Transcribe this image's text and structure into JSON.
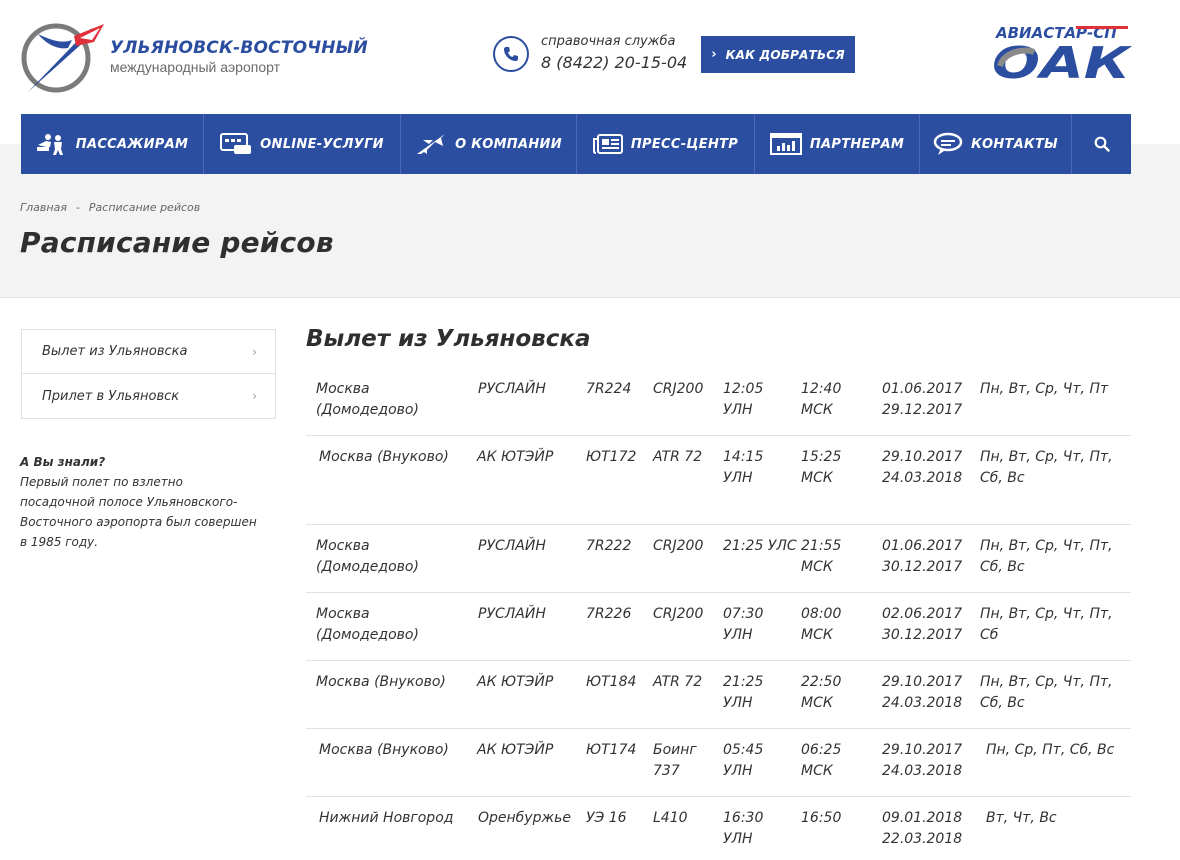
{
  "header": {
    "logo_title": "УЛЬЯНОВСК-ВОСТОЧНЫЙ",
    "logo_subtitle": "международный аэропорт",
    "phone_label": "справочная служба",
    "phone_number": "8 (8422) 20-15-04",
    "route_button": "КАК ДОБРАТЬСЯ",
    "partner_logo_top": "АВИАСТАР-СП",
    "partner_logo_main": "ОАК"
  },
  "nav": {
    "items": [
      {
        "label": "ПАССАЖИРАМ",
        "icon": "passengers-icon"
      },
      {
        "label": "ONLINE-УСЛУГИ",
        "icon": "online-services-icon"
      },
      {
        "label": "О КОМПАНИИ",
        "icon": "airplane-icon"
      },
      {
        "label": "ПРЕСС-ЦЕНТР",
        "icon": "newspaper-icon"
      },
      {
        "label": "ПАРТНЕРАМ",
        "icon": "chart-icon"
      },
      {
        "label": "КОНТАКТЫ",
        "icon": "chat-bubbles-icon"
      }
    ],
    "search_icon": "search-icon"
  },
  "breadcrumb": {
    "home": "Главная",
    "separator": "-",
    "current": "Расписание рейсов"
  },
  "page_title": "Расписание рейсов",
  "sidebar": {
    "items": [
      {
        "label": "Вылет из Ульяновска"
      },
      {
        "label": "Прилет в Ульяновск"
      }
    ],
    "fact_title": "А Вы знали?",
    "fact_text": "Первый полет по взлетно посадочной полосе Ульяновского-Восточного аэропорта был совершен в 1985 году."
  },
  "schedule": {
    "title": "Вылет из Ульяновска",
    "rows": [
      {
        "dest": "Москва (Домодедово)",
        "airline": "РУСЛАЙН",
        "flight": "7R224",
        "aircraft": "CRJ200",
        "dep": "12:05 УЛН",
        "arr": "12:40 МСК",
        "period": "01.06.2017 29.12.2017",
        "days": "Пн, Вт, Ср, Чт, Пт"
      },
      {
        "dest": "Москва (Внуково)",
        "airline": "АК ЮТЭЙР",
        "flight": "ЮТ172",
        "aircraft": "ATR 72",
        "dep": "14:15 УЛН",
        "arr": "15:25 МСК",
        "period": "29.10.2017 24.03.2018",
        "days": "Пн, Вт, Ср, Чт, Пт, Сб, Вс"
      },
      {
        "dest": "Москва (Домодедово)",
        "airline": "РУСЛАЙН",
        "flight": "7R222",
        "aircraft": "CRJ200",
        "dep": "21:25 УЛС",
        "arr": "21:55 МСК",
        "period": "01.06.2017 30.12.2017",
        "days": "Пн, Вт, Ср, Чт, Пт, Сб, Вс"
      },
      {
        "dest": "Москва (Домодедово)",
        "airline": "РУСЛАЙН",
        "flight": "7R226",
        "aircraft": "CRJ200",
        "dep": "07:30 УЛН",
        "arr": "08:00 МСК",
        "period": "02.06.2017 30.12.2017",
        "days": "Пн, Вт, Ср, Чт, Пт, Сб"
      },
      {
        "dest": "Москва (Внуково)",
        "airline": "АК ЮТЭЙР",
        "flight": "ЮТ184",
        "aircraft": "ATR 72",
        "dep": "21:25 УЛН",
        "arr": "22:50 МСК",
        "period": "29.10.2017 24.03.2018",
        "days": "Пн, Вт, Ср, Чт, Пт, Сб, Вс"
      },
      {
        "dest": "Москва (Внуково)",
        "airline": "АК ЮТЭЙР",
        "flight": "ЮТ174",
        "aircraft": "Боинг 737",
        "dep": "05:45 УЛН",
        "arr": "06:25 МСК",
        "period": "29.10.2017 24.03.2018",
        "days": "Пн, Ср, Пт, Сб, Вс"
      },
      {
        "dest": "Нижний Новгород",
        "airline": "Оренбуржье",
        "flight": "УЭ 16",
        "aircraft": "L410",
        "dep": "16:30 УЛН",
        "arr": "16:50",
        "period": "09.01.2018 22.03.2018",
        "days": "Вт, Чт, Вс"
      }
    ]
  },
  "colors": {
    "brand_blue": "#2b4ea1",
    "accent_red": "#e0303a",
    "band_grey": "#f3f3f3"
  }
}
